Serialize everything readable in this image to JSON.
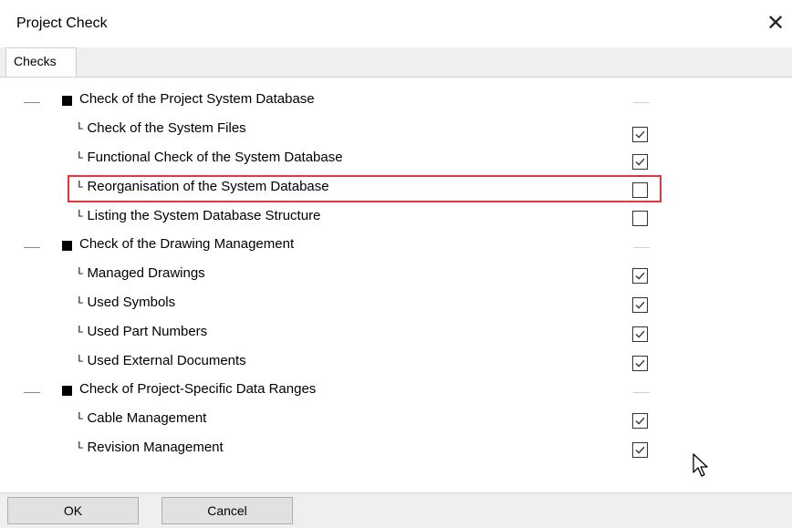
{
  "window": {
    "title": "Project Check"
  },
  "tabs": [
    {
      "label": "Checks"
    }
  ],
  "checks": {
    "g1": {
      "label": "Check of the Project System Database"
    },
    "i1": {
      "label": "ᴸ Check of the System Files",
      "checked": true
    },
    "i2": {
      "label": "ᴸ Functional Check of the System Database",
      "checked": true
    },
    "i3": {
      "label": "ᴸ Reorganisation of the System Database",
      "checked": false
    },
    "i4": {
      "label": "ᴸ Listing the System Database Structure",
      "checked": false
    },
    "g2": {
      "label": "Check of the Drawing Management"
    },
    "i5": {
      "label": "ᴸ Managed Drawings",
      "checked": true
    },
    "i6": {
      "label": "ᴸ Used Symbols",
      "checked": true
    },
    "i7": {
      "label": "ᴸ Used Part Numbers",
      "checked": true
    },
    "i8": {
      "label": "ᴸ Used External Documents",
      "checked": true
    },
    "g3": {
      "label": "Check of Project-Specific Data Ranges"
    },
    "i9": {
      "label": "ᴸ Cable Management",
      "checked": true
    },
    "i10": {
      "label": "ᴸ Revision Management",
      "checked": true
    }
  },
  "buttons": {
    "ok": "OK",
    "cancel": "Cancel"
  },
  "icons": {
    "close": "close-icon",
    "cursor": "mouse-pointer-icon",
    "bullet": "black-square-bullet-icon"
  },
  "colors": {
    "highlight": "#e0363f",
    "footer": "#efefef"
  }
}
